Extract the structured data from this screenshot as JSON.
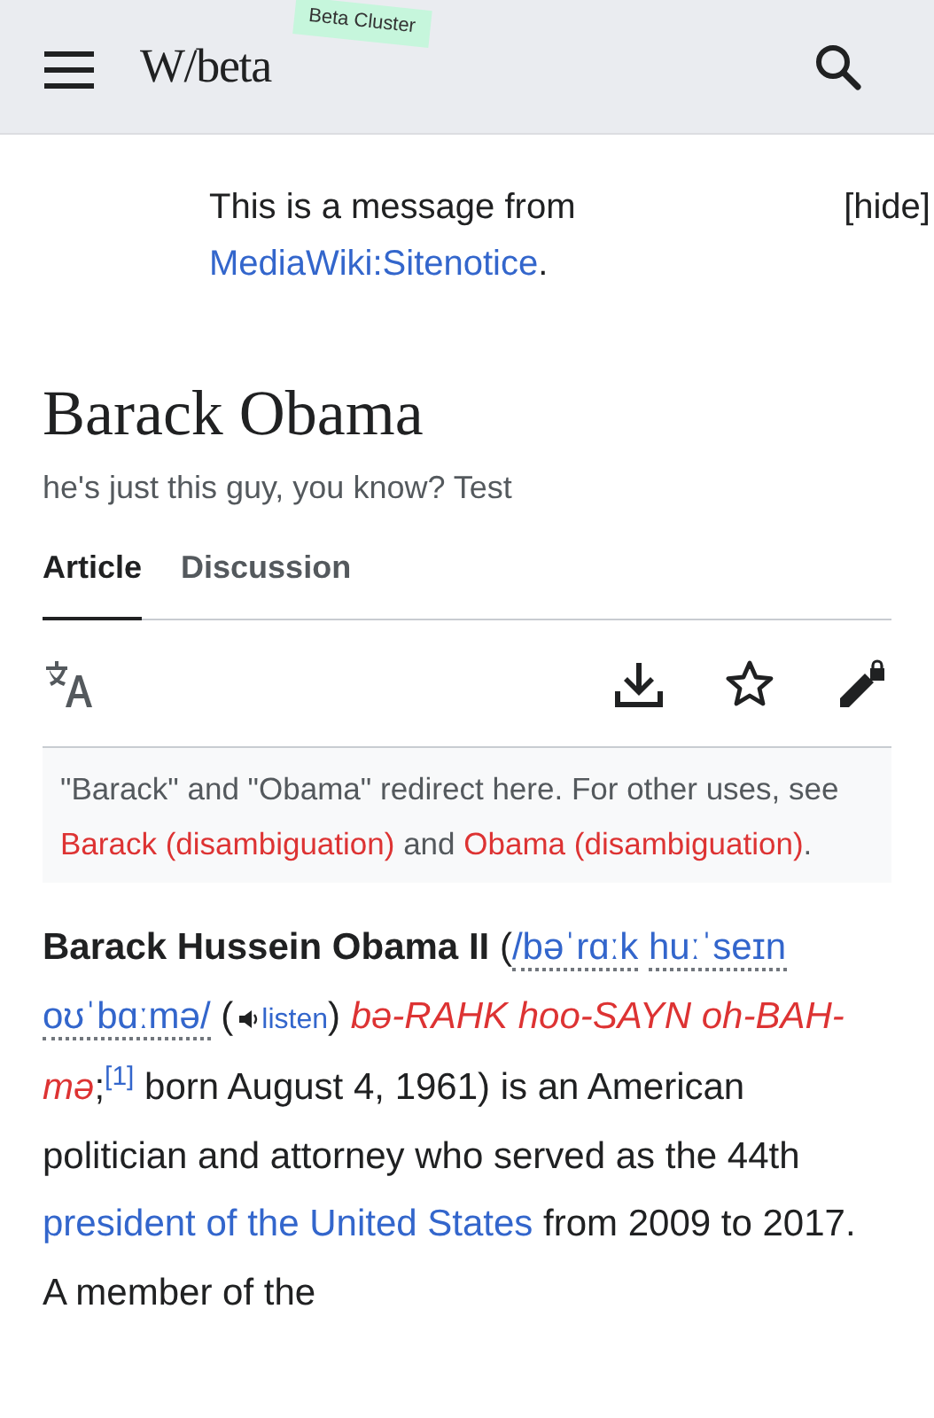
{
  "header": {
    "logo": "W/beta",
    "badge": "Beta Cluster"
  },
  "sitenotice": {
    "segments": [
      {
        "kind": "text",
        "text": "This is a message from "
      },
      {
        "kind": "link",
        "text": "MediaWiki:Sitenotice"
      },
      {
        "kind": "text",
        "text": "."
      }
    ],
    "hide": "[hide]"
  },
  "title": "Barack Obama",
  "tagline": "he's just this guy, you know? Test",
  "tabs": [
    {
      "label": "Article",
      "selected": true
    },
    {
      "label": "Discussion",
      "selected": false
    }
  ],
  "toolbar": [
    {
      "kind": "language"
    },
    {
      "kind": "download"
    },
    {
      "kind": "watch"
    },
    {
      "kind": "edit-protected"
    }
  ],
  "hatnote": [
    {
      "kind": "text",
      "text": "\"Barack\" and \"Obama\" redirect here. For other uses, see "
    },
    {
      "kind": "redlink",
      "text": "Barack (disambiguation)"
    },
    {
      "kind": "text",
      "text": " and "
    },
    {
      "kind": "redlink",
      "text": "Obama"
    },
    {
      "kind": "space"
    },
    {
      "kind": "redlink",
      "text": "(disambiguation)"
    },
    {
      "kind": "text",
      "text": "."
    }
  ],
  "lead": [
    {
      "kind": "bold",
      "text": "Barack Hussein Obama II"
    },
    {
      "kind": "text",
      "text": " ("
    },
    {
      "kind": "ipa",
      "text": "/bəˈrɑːk"
    },
    {
      "kind": "space"
    },
    {
      "kind": "ipa",
      "text": "huːˈseɪn"
    },
    {
      "kind": "space"
    },
    {
      "kind": "ipa",
      "text": "oʊˈbɑːmə/"
    },
    {
      "kind": "text",
      "text": " ("
    },
    {
      "kind": "audio",
      "text": "listen"
    },
    {
      "kind": "text",
      "text": ") "
    },
    {
      "kind": "respell",
      "text": "bə-RAHK hoo-SAYN oh-BAH-mə"
    },
    {
      "kind": "text",
      "text": ";"
    },
    {
      "kind": "ref",
      "text": "[1]"
    },
    {
      "kind": "text",
      "text": " born August 4, 1961) is an American politician and attorney who served as the 44th "
    },
    {
      "kind": "link",
      "text": "president of the United States"
    },
    {
      "kind": "text",
      "text": " from 2009 to 2017. A member of the"
    }
  ]
}
